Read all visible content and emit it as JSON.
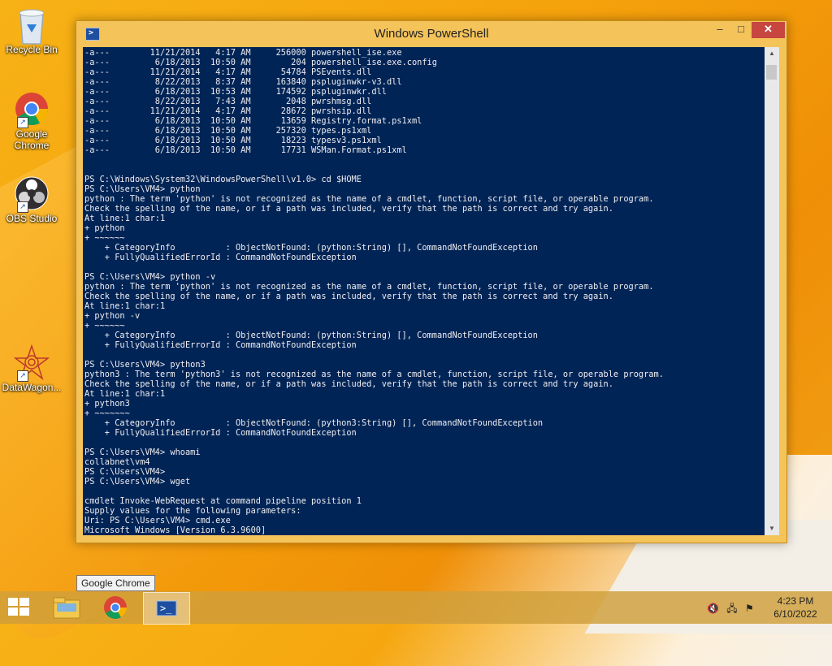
{
  "desktop": {
    "icons": [
      {
        "label": "Recycle Bin"
      },
      {
        "label": "Google Chrome"
      },
      {
        "label": "OBS Studio"
      },
      {
        "label": "DataWagon..."
      }
    ]
  },
  "window": {
    "title": "Windows PowerShell",
    "buttons": {
      "minimize": "–",
      "maximize": "□",
      "close": "✕"
    }
  },
  "console": {
    "lines": [
      "-a---        11/21/2014   4:17 AM     256000 powershell_ise.exe",
      "-a---         6/18/2013  10:50 AM        204 powershell_ise.exe.config",
      "-a---        11/21/2014   4:17 AM      54784 PSEvents.dll",
      "-a---         8/22/2013   8:37 AM     163840 pspluginwkr-v3.dll",
      "-a---         6/18/2013  10:53 AM     174592 pspluginwkr.dll",
      "-a---         8/22/2013   7:43 AM       2048 pwrshmsg.dll",
      "-a---        11/21/2014   4:17 AM      28672 pwrshsip.dll",
      "-a---         6/18/2013  10:50 AM      13659 Registry.format.ps1xml",
      "-a---         6/18/2013  10:50 AM     257320 types.ps1xml",
      "-a---         6/18/2013  10:50 AM      18223 typesv3.ps1xml",
      "-a---         6/18/2013  10:50 AM      17731 WSMan.Format.ps1xml",
      "",
      "",
      "PS C:\\Windows\\System32\\WindowsPowerShell\\v1.0> cd $HOME",
      "PS C:\\Users\\VM4> python",
      "python : The term 'python' is not recognized as the name of a cmdlet, function, script file, or operable program.",
      "Check the spelling of the name, or if a path was included, verify that the path is correct and try again.",
      "At line:1 char:1",
      "+ python",
      "+ ~~~~~~",
      "    + CategoryInfo          : ObjectNotFound: (python:String) [], CommandNotFoundException",
      "    + FullyQualifiedErrorId : CommandNotFoundException",
      "",
      "PS C:\\Users\\VM4> python -v",
      "python : The term 'python' is not recognized as the name of a cmdlet, function, script file, or operable program.",
      "Check the spelling of the name, or if a path was included, verify that the path is correct and try again.",
      "At line:1 char:1",
      "+ python -v",
      "+ ~~~~~~",
      "    + CategoryInfo          : ObjectNotFound: (python:String) [], CommandNotFoundException",
      "    + FullyQualifiedErrorId : CommandNotFoundException",
      "",
      "PS C:\\Users\\VM4> python3",
      "python3 : The term 'python3' is not recognized as the name of a cmdlet, function, script file, or operable program.",
      "Check the spelling of the name, or if a path was included, verify that the path is correct and try again.",
      "At line:1 char:1",
      "+ python3",
      "+ ~~~~~~~",
      "    + CategoryInfo          : ObjectNotFound: (python3:String) [], CommandNotFoundException",
      "    + FullyQualifiedErrorId : CommandNotFoundException",
      "",
      "PS C:\\Users\\VM4> whoami",
      "collabnet\\vm4",
      "PS C:\\Users\\VM4>",
      "PS C:\\Users\\VM4> wget",
      "",
      "cmdlet Invoke-WebRequest at command pipeline position 1",
      "Supply values for the following parameters:",
      "Uri: PS C:\\Users\\VM4> cmd.exe",
      "Microsoft Windows [Version 6.3.9600]"
    ]
  },
  "tooltip": {
    "text": "Google Chrome"
  },
  "taskbar": {
    "items": [
      "start-button",
      "file-explorer",
      "google-chrome",
      "windows-powershell"
    ],
    "clock": {
      "time": "4:23 PM",
      "date": "6/10/2022"
    }
  }
}
